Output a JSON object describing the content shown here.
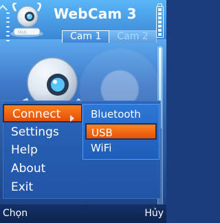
{
  "app": {
    "title": "WebCam 3"
  },
  "tabs": [
    {
      "label": "Cam 1",
      "active": true
    },
    {
      "label": "Cam 2",
      "active": false
    }
  ],
  "menu": {
    "items": [
      {
        "label": "Connect",
        "selected": true
      },
      {
        "label": "Settings",
        "selected": false
      },
      {
        "label": "Help",
        "selected": false
      },
      {
        "label": "About",
        "selected": false
      },
      {
        "label": "Exit",
        "selected": false
      }
    ]
  },
  "submenu": {
    "items": [
      {
        "label": "Bluetooth",
        "selected": false
      },
      {
        "label": "USB",
        "selected": true
      },
      {
        "label": "WiFi",
        "selected": false
      }
    ]
  },
  "softkeys": {
    "left": "Chọn",
    "right": "Hủy"
  },
  "icons": {
    "signal": "signal-icon",
    "battery": "battery-icon",
    "mascot": "webcam-mascot-icon"
  },
  "colors": {
    "accent": "#ff6a14",
    "menu_bg": "#2a63b6",
    "softkey_bg": "#102b5c"
  }
}
